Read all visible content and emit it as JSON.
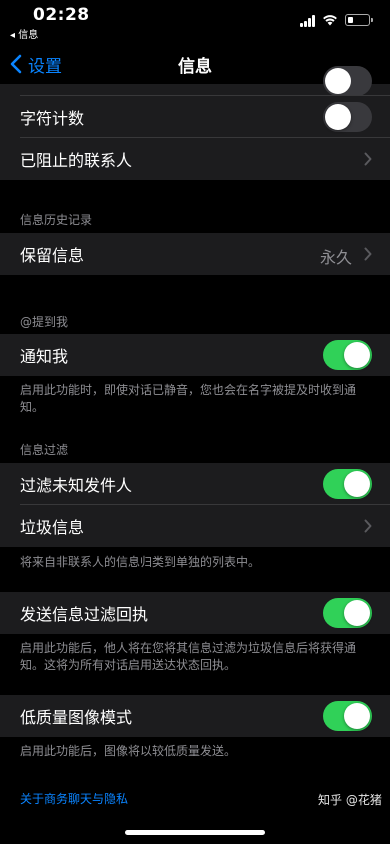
{
  "status": {
    "time": "02:28",
    "back_app": "◂ 信息"
  },
  "nav": {
    "back_label": "设置",
    "title": "信息"
  },
  "group1": {
    "rows": [
      {
        "label": "字符计数",
        "toggle": "off"
      },
      {
        "label": "已阻止的联系人"
      }
    ]
  },
  "history": {
    "header": "信息历史记录",
    "keep_label": "保留信息",
    "keep_value": "永久"
  },
  "mentions": {
    "header": "@提到我",
    "notify_label": "通知我",
    "notify_toggle": "on",
    "footer": "启用此功能时，即使对话已静音，您也会在名字被提及时收到通知。"
  },
  "filter": {
    "header": "信息过滤",
    "unknown_label": "过滤未知发件人",
    "unknown_toggle": "on",
    "junk_label": "垃圾信息",
    "footer": "将来自非联系人的信息归类到单独的列表中。"
  },
  "receipts": {
    "label": "发送信息过滤回执",
    "toggle": "on",
    "footer": "启用此功能后，他人将在您将其信息过滤为垃圾信息后将获得通知。这将为所有对话启用送达状态回执。"
  },
  "lowquality": {
    "label": "低质量图像模式",
    "toggle": "on",
    "footer": "启用此功能后，图像将以较低质量发送。"
  },
  "privacy_link": "关于商务聊天与隐私",
  "watermark": "知乎 @花猪",
  "colors": {
    "accent": "#0a84ff",
    "toggle_on": "#30d158",
    "cell": "#1c1c1e",
    "background": "#000000"
  }
}
